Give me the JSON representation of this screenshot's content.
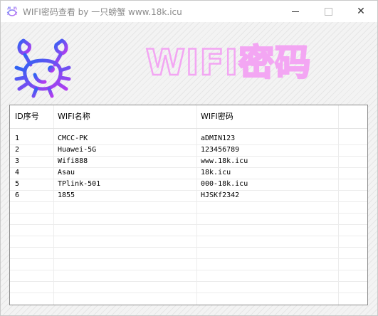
{
  "window": {
    "title": "WIFI密码查看    by 一只螃蟹    www.18k.icu",
    "close_glyph": "✕"
  },
  "banner": {
    "text": "WIFI密码"
  },
  "colors": {
    "banner_pink": "#f3a6f3",
    "mascot_blue": "#2f63f3",
    "mascot_purple": "#b43cf0"
  },
  "icons": [
    "crab-icon",
    "minimize-icon",
    "maximize-icon",
    "close-icon"
  ],
  "table": {
    "headers": [
      "ID序号",
      "WIFI名称",
      "WIFI密码"
    ],
    "rows": [
      [
        "1",
        "CMCC-PK",
        "aDMIN123"
      ],
      [
        "2",
        "Huawei-5G",
        "123456789"
      ],
      [
        "3",
        "Wifi888",
        "www.18k.icu"
      ],
      [
        "4",
        "Asau",
        "18k.icu"
      ],
      [
        "5",
        "TPlink-501",
        "000-18k.icu"
      ],
      [
        "6",
        "1855",
        "HJSKf2342"
      ],
      [
        "",
        "",
        ""
      ],
      [
        "",
        "",
        ""
      ],
      [
        "",
        "",
        ""
      ],
      [
        "",
        "",
        ""
      ],
      [
        "",
        "",
        ""
      ],
      [
        "",
        "",
        ""
      ],
      [
        "",
        "",
        ""
      ],
      [
        "",
        "",
        ""
      ]
    ]
  }
}
